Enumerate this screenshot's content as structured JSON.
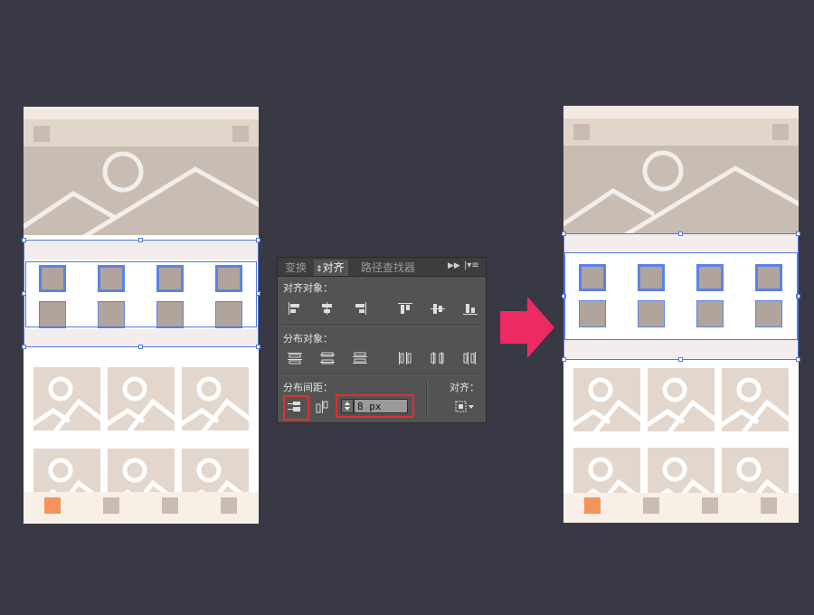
{
  "panel": {
    "tabs": [
      "变换",
      "对齐",
      "路径查找器"
    ],
    "menu_icons": [
      "collapse-icon",
      "panel-menu-icon"
    ],
    "align_objects_label": "对齐对象：",
    "distribute_objects_label": "分布对象：",
    "distribute_spacing_label": "分布间距：",
    "align_to_label": "对齐：",
    "spacing_value": "8 px"
  },
  "colors": {
    "background": "#393845",
    "accent_arrow": "#ee2a63",
    "selection": "#4f78e0",
    "highlight": "#e0302c",
    "orange_tab": "#f4935c"
  }
}
